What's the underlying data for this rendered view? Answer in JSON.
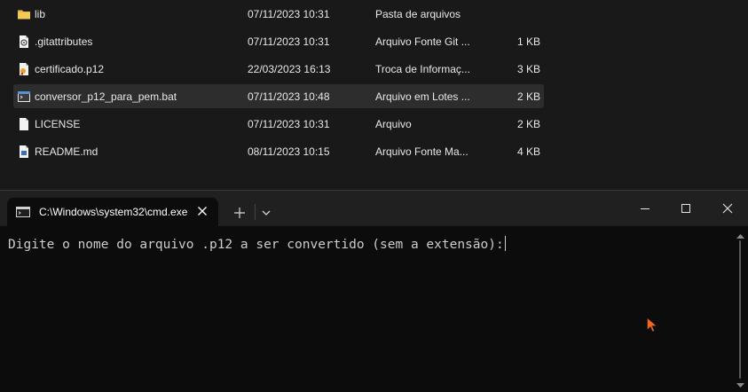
{
  "explorer": {
    "files": [
      {
        "name": "lib",
        "date": "07/11/2023 10:31",
        "type": "Pasta de arquivos",
        "size": "",
        "icon": "folder-icon",
        "selected": false
      },
      {
        "name": ".gitattributes",
        "date": "07/11/2023 10:31",
        "type": "Arquivo Fonte Git ...",
        "size": "1 KB",
        "icon": "gitattributes-file-icon",
        "selected": false
      },
      {
        "name": "certificado.p12",
        "date": "22/03/2023 16:13",
        "type": "Troca de Informaç...",
        "size": "3 KB",
        "icon": "certificate-file-icon",
        "selected": false
      },
      {
        "name": "conversor_p12_para_pem.bat",
        "date": "07/11/2023 10:48",
        "type": "Arquivo em Lotes ...",
        "size": "2 KB",
        "icon": "batch-file-icon",
        "selected": true
      },
      {
        "name": "LICENSE",
        "date": "07/11/2023 10:31",
        "type": "Arquivo",
        "size": "2 KB",
        "icon": "blank-file-icon",
        "selected": false
      },
      {
        "name": "README.md",
        "date": "08/11/2023 10:15",
        "type": "Arquivo Fonte Ma...",
        "size": "4 KB",
        "icon": "markdown-file-icon",
        "selected": false
      }
    ]
  },
  "terminal": {
    "tab_title": "C:\\Windows\\system32\\cmd.exe",
    "prompt_text": "Digite o nome do arquivo .p12 a ser convertido (sem a extensão):"
  },
  "colors": {
    "terminal_background": "#0c0c0c",
    "titlebar_background": "#202020",
    "explorer_background": "#191919",
    "selected_row": "#2d2d2d",
    "folder_yellow": "#e8b94a",
    "mouse_pointer": "#f26522"
  }
}
